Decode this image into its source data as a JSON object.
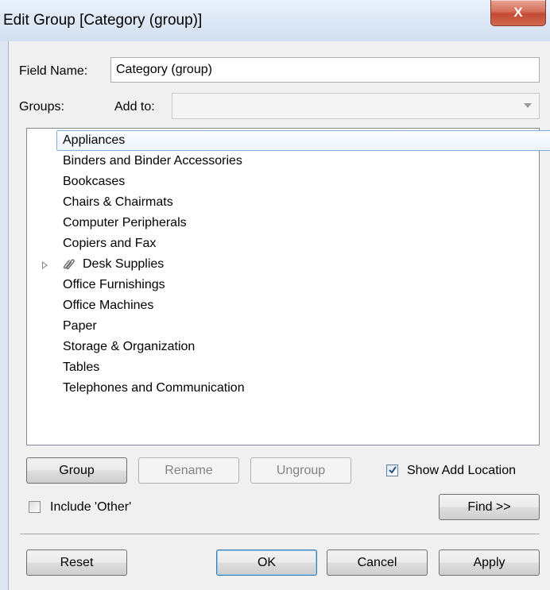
{
  "window": {
    "title": "Edit Group [Category (group)]",
    "close_glyph": "X"
  },
  "field": {
    "label": "Field Name:",
    "value": "Category (group)"
  },
  "groups": {
    "label": "Groups:",
    "add_to_label": "Add to:",
    "add_to_value": ""
  },
  "list": {
    "items": [
      {
        "label": "Appliances",
        "selected": true
      },
      {
        "label": "Binders and Binder Accessories"
      },
      {
        "label": "Bookcases"
      },
      {
        "label": "Chairs & Chairmats"
      },
      {
        "label": "Computer Peripherals"
      },
      {
        "label": "Copiers and Fax"
      },
      {
        "label": "Desk Supplies",
        "is_group": true,
        "icon": "paperclip-icon",
        "expander": "collapsed"
      },
      {
        "label": "Office Furnishings"
      },
      {
        "label": "Office Machines"
      },
      {
        "label": "Paper"
      },
      {
        "label": "Storage & Organization"
      },
      {
        "label": "Tables"
      },
      {
        "label": "Telephones and Communication"
      }
    ]
  },
  "actions": {
    "group": "Group",
    "rename": "Rename",
    "ungroup": "Ungroup",
    "show_add_location": "Show Add Location",
    "show_add_location_checked": true,
    "include_other": "Include 'Other'",
    "include_other_checked": false,
    "find": "Find >>"
  },
  "footer": {
    "reset": "Reset",
    "ok": "OK",
    "cancel": "Cancel",
    "apply": "Apply"
  }
}
